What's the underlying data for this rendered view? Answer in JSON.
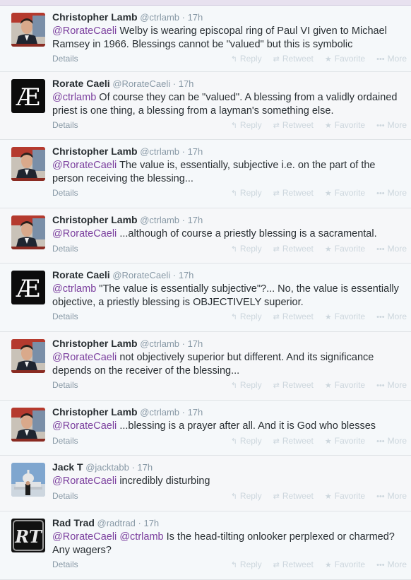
{
  "colors": {
    "mention": "#7b3f9e",
    "muted": "#8899a6",
    "actions": "#ccd6dd"
  },
  "labels": {
    "details": "Details",
    "reply": "Reply",
    "retweet": "Retweet",
    "favorite": "Favorite",
    "more": "More"
  },
  "tweets": [
    {
      "name": "Christopher Lamb",
      "handle": "@ctrlamb",
      "time": "17h",
      "avatar": "lamb-avatar",
      "parts": [
        {
          "t": "@RorateCaeli",
          "m": true
        },
        {
          "t": " Welby is wearing episcopal ring of Paul VI given to Michael Ramsey in 1966. Blessings cannot be \"valued\" but this is symbolic"
        }
      ]
    },
    {
      "name": "Rorate Caeli",
      "handle": "@RorateCaeli",
      "time": "17h",
      "avatar": "ae-avatar",
      "parts": [
        {
          "t": "@ctrlamb",
          "m": true
        },
        {
          "t": " Of course they can be \"valued\". A blessing from a validly ordained priest is one thing, a blessing from a layman's something else."
        }
      ]
    },
    {
      "name": "Christopher Lamb",
      "handle": "@ctrlamb",
      "time": "17h",
      "avatar": "lamb-avatar",
      "parts": [
        {
          "t": "@RorateCaeli",
          "m": true
        },
        {
          "t": " The value is, essentially, subjective i.e. on the part of the person receiving the blessing..."
        }
      ]
    },
    {
      "name": "Christopher Lamb",
      "handle": "@ctrlamb",
      "time": "17h",
      "avatar": "lamb-avatar",
      "parts": [
        {
          "t": "@RorateCaeli",
          "m": true
        },
        {
          "t": " ...although of course a priestly blessing is a sacramental."
        }
      ]
    },
    {
      "name": "Rorate Caeli",
      "handle": "@RorateCaeli",
      "time": "17h",
      "avatar": "ae-avatar",
      "parts": [
        {
          "t": "@ctrlamb",
          "m": true
        },
        {
          "t": " \"The value is essentially subjective\"?... No, the value is essentially objective, a priestly blessing is OBJECTIVELY superior."
        }
      ]
    },
    {
      "name": "Christopher Lamb",
      "handle": "@ctrlamb",
      "time": "17h",
      "avatar": "lamb-avatar",
      "parts": [
        {
          "t": "@RorateCaeli",
          "m": true
        },
        {
          "t": " not objectively superior but different. And its significance depends on the receiver of the blessing..."
        }
      ]
    },
    {
      "name": "Christopher Lamb",
      "handle": "@ctrlamb",
      "time": "17h",
      "avatar": "lamb-avatar",
      "parts": [
        {
          "t": "@RorateCaeli",
          "m": true
        },
        {
          "t": " ...blessing is a prayer after all. And it is God who blesses"
        }
      ]
    },
    {
      "name": "Jack T",
      "handle": "@jacktabb",
      "time": "17h",
      "avatar": "capitol-avatar",
      "parts": [
        {
          "t": "@RorateCaeli",
          "m": true
        },
        {
          "t": " incredibly disturbing"
        }
      ]
    },
    {
      "name": "Rad Trad",
      "handle": "@radtrad",
      "time": "17h",
      "avatar": "rt-avatar",
      "parts": [
        {
          "t": "@RorateCaeli",
          "m": true
        },
        {
          "t": " "
        },
        {
          "t": "@ctrlamb",
          "m": true
        },
        {
          "t": " Is the head-tilting onlooker perplexed or charmed? Any wagers?"
        }
      ]
    }
  ]
}
